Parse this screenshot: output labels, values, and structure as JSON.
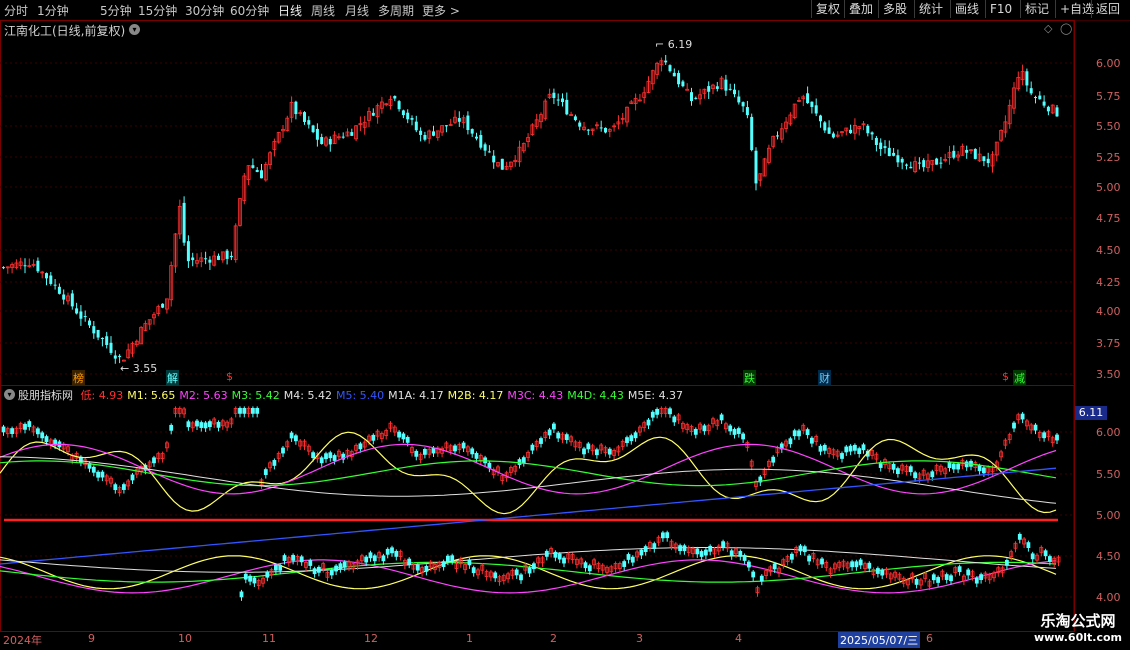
{
  "toolbar": {
    "periods": [
      "分时",
      "1分钟",
      "5分钟",
      "15分钟",
      "30分钟",
      "60分钟",
      "日线",
      "周线",
      "月线",
      "多周期",
      "更多 >"
    ],
    "active_period": "日线",
    "tools": [
      "复权",
      "叠加",
      "多股",
      "统计",
      "画线",
      "F10",
      "标记",
      "+自选",
      "返回"
    ]
  },
  "header": {
    "title": "江南化工(日线,前复权)"
  },
  "main_chart": {
    "price_ticks": [
      "6.00",
      "5.75",
      "5.50",
      "5.25",
      "5.00",
      "4.75",
      "4.50",
      "4.25",
      "4.00",
      "3.75",
      "3.50"
    ],
    "high_label": "6.19",
    "low_label": "3.55",
    "badges": [
      {
        "text": "榜",
        "color": "#ff9900"
      },
      {
        "text": "解",
        "color": "#66ffff"
      },
      {
        "text": "$",
        "color": "#ff3030"
      },
      {
        "text": "跌",
        "color": "#33ff33"
      },
      {
        "text": "财",
        "color": "#66ccff"
      },
      {
        "text": "$",
        "color": "#ff3030"
      },
      {
        "text": "减",
        "color": "#33ff33"
      }
    ]
  },
  "indicator": {
    "name": "股朋指标网",
    "values": [
      {
        "label": "低:",
        "value": "4.93",
        "color": "#ff3030"
      },
      {
        "label": "M1:",
        "value": "5.65",
        "color": "#ffff66"
      },
      {
        "label": "M2:",
        "value": "5.63",
        "color": "#ff44ff"
      },
      {
        "label": "M3:",
        "value": "5.42",
        "color": "#33ff33"
      },
      {
        "label": "M4:",
        "value": "5.42",
        "color": "#e0e0e0"
      },
      {
        "label": "M5:",
        "value": "5.40",
        "color": "#3355ff"
      },
      {
        "label": "M1A:",
        "value": "4.17",
        "color": "#e0e0e0"
      },
      {
        "label": "M2B:",
        "value": "4.17",
        "color": "#ffff66"
      },
      {
        "label": "M3C:",
        "value": "4.43",
        "color": "#ff44ff"
      },
      {
        "label": "M4D:",
        "value": "4.43",
        "color": "#33ff33"
      },
      {
        "label": "M5E:",
        "value": "4.37",
        "color": "#e0e0e0"
      }
    ],
    "ticks": [
      "6.00",
      "5.50",
      "5.00",
      "4.50",
      "4.00"
    ],
    "last_price": "6.11"
  },
  "date_axis": {
    "labels": [
      "2024年",
      "9",
      "10",
      "11",
      "12",
      "1",
      "2",
      "3",
      "4",
      "2025/05/07/三",
      "6"
    ]
  },
  "watermark": {
    "line1": "乐淘公式网",
    "line2": "www.60lt.com"
  },
  "colors": {
    "up": "#ff3030",
    "down": "#54ffff",
    "axis": "#7a0000"
  }
}
